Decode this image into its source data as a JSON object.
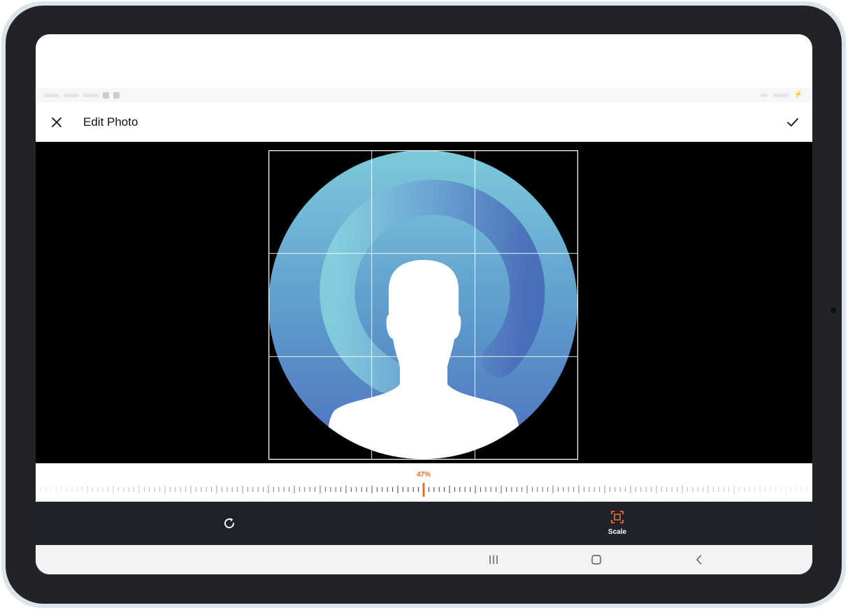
{
  "header": {
    "title": "Edit Photo",
    "close_icon": "close-icon",
    "done_icon": "check-icon"
  },
  "editor": {
    "image": "default-avatar-silhouette",
    "crop_grid": "3x3"
  },
  "zoom": {
    "value_label": "47%",
    "value": 47
  },
  "toolbar": {
    "rotate_icon": "rotate-icon",
    "scale_icon": "scale-icon",
    "scale_label": "Scale"
  },
  "navbar": {
    "recents_icon": "recent-apps-icon",
    "home_icon": "home-icon",
    "back_icon": "back-icon"
  },
  "colors": {
    "accent": "#f26b1d",
    "toolbar_bg": "#20232c",
    "canvas_bg": "#000000",
    "avatar_light": "#7ccadb",
    "avatar_dark": "#4f6fbf"
  }
}
